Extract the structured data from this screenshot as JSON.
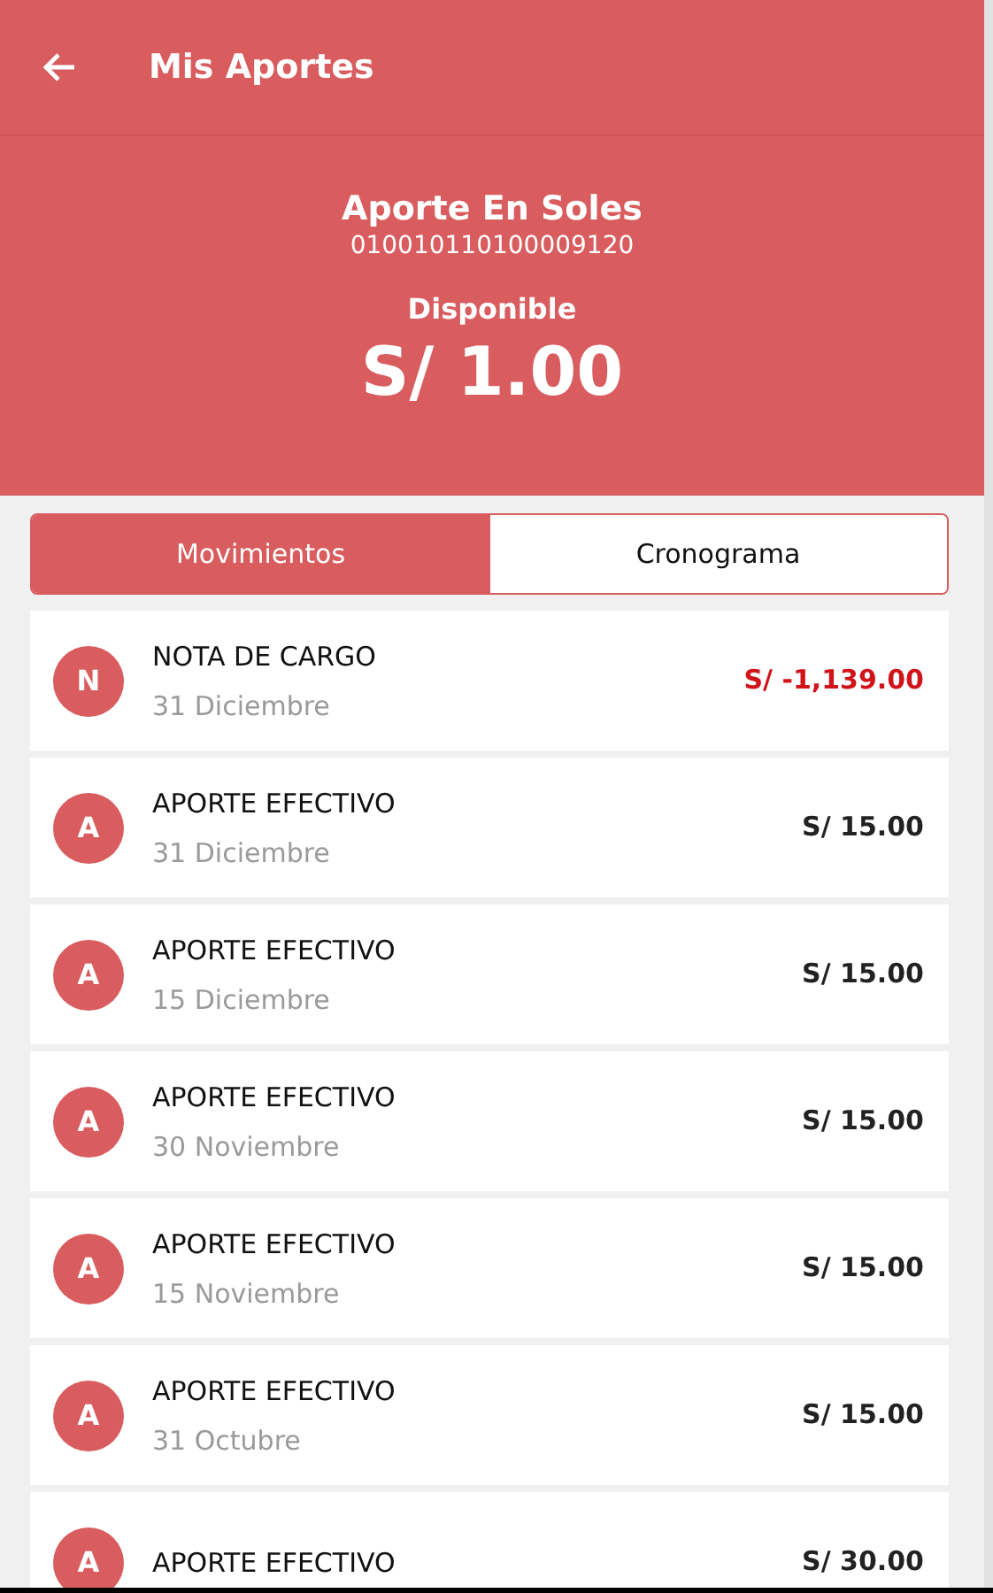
{
  "toolbar": {
    "title": "Mis Aportes"
  },
  "summary": {
    "account_name": "Aporte En Soles",
    "account_number": "010010110100009120",
    "balance_label": "Disponible",
    "balance": "S/ 1.00"
  },
  "tabs": [
    {
      "label": "Movimientos",
      "selected": true
    },
    {
      "label": "Cronograma",
      "selected": false
    }
  ],
  "movements": [
    {
      "initial": "N",
      "title": "NOTA DE CARGO",
      "date": "31 Diciembre",
      "amount": "S/ -1,139.00",
      "kind": "debit"
    },
    {
      "initial": "A",
      "title": "APORTE EFECTIVO",
      "date": "31 Diciembre",
      "amount": "S/ 15.00",
      "kind": "credit"
    },
    {
      "initial": "A",
      "title": "APORTE EFECTIVO",
      "date": "15 Diciembre",
      "amount": "S/ 15.00",
      "kind": "credit"
    },
    {
      "initial": "A",
      "title": "APORTE EFECTIVO",
      "date": "30 Noviembre",
      "amount": "S/ 15.00",
      "kind": "credit"
    },
    {
      "initial": "A",
      "title": "APORTE EFECTIVO",
      "date": "15 Noviembre",
      "amount": "S/ 15.00",
      "kind": "credit"
    },
    {
      "initial": "A",
      "title": "APORTE EFECTIVO",
      "date": "31 Octubre",
      "amount": "S/ 15.00",
      "kind": "credit"
    },
    {
      "initial": "A",
      "title": "APORTE EFECTIVO",
      "amount": "S/ 30.00",
      "kind": "credit"
    }
  ]
}
